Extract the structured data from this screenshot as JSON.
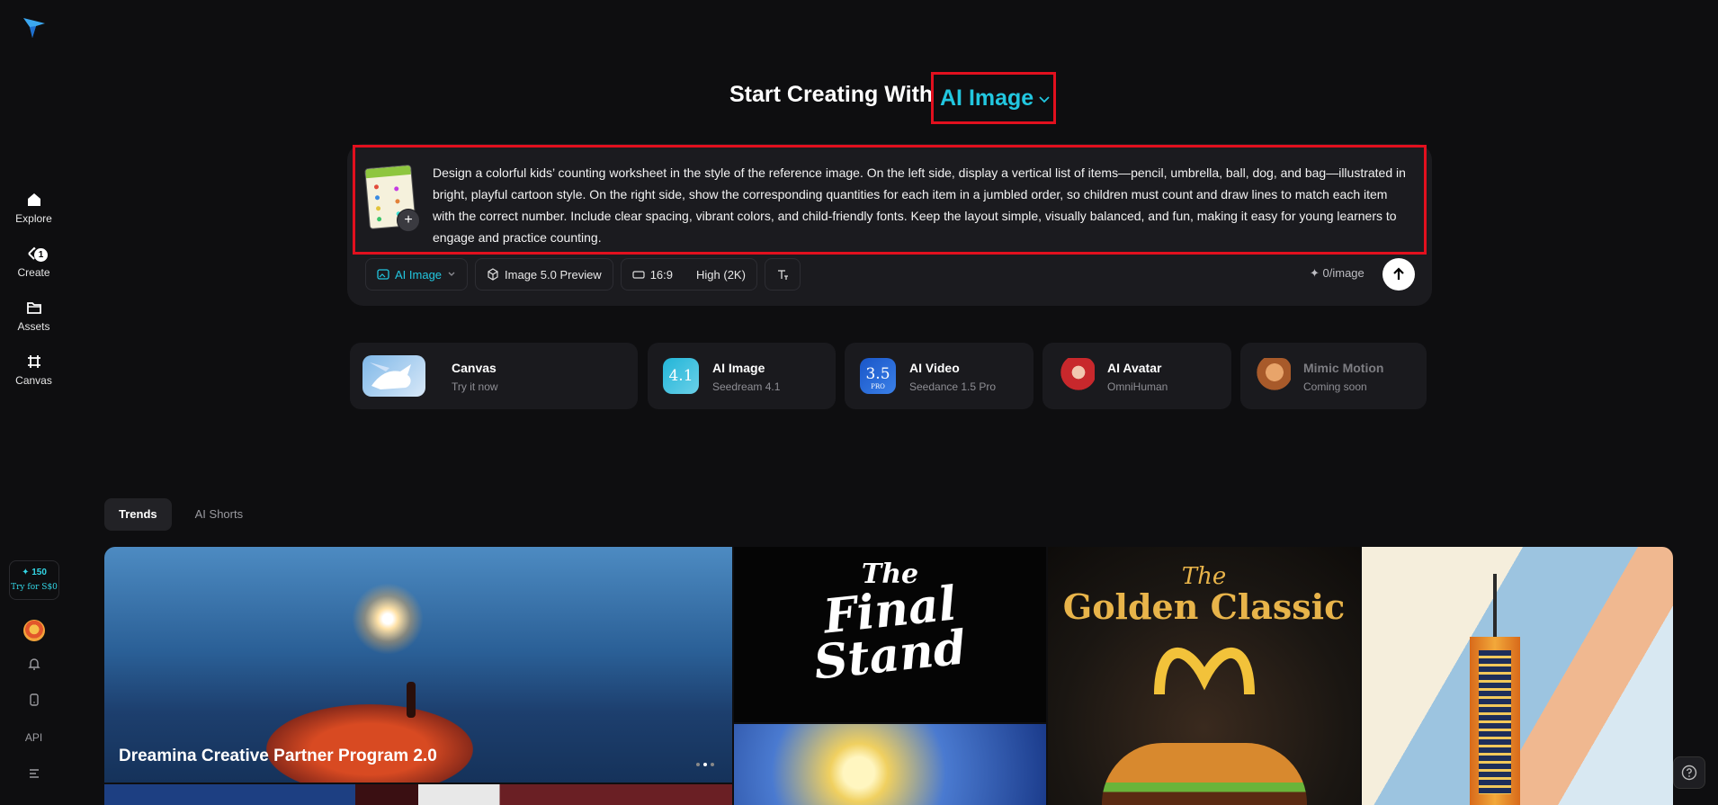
{
  "sidebar": {
    "items": [
      {
        "label": "Explore",
        "icon": "home-icon"
      },
      {
        "label": "Create",
        "icon": "create-icon",
        "badge": "1"
      },
      {
        "label": "Assets",
        "icon": "folder-icon"
      },
      {
        "label": "Canvas",
        "icon": "canvas-icon"
      }
    ],
    "credits": {
      "amount": "✦ 150",
      "cta": "Try for S$0"
    },
    "api_label": "API"
  },
  "headline": {
    "prefix": "Start Creating With",
    "mode": "AI Image"
  },
  "composer": {
    "prompt": "Design a colorful kids’ counting worksheet in the style of the reference image. On the left side, display a vertical list of items—pencil, umbrella, ball, dog, and bag—illustrated in bright, playful cartoon style. On the right side, show the corresponding quantities for each item in a jumbled order, so children must count and draw lines to match each item with the correct number. Include clear spacing, vibrant colors, and child-friendly fonts. Keep the layout simple, visually balanced, and fun, making it easy for young learners to engage and practice counting.",
    "add_symbol": "+",
    "toolbar": {
      "mode": "AI Image",
      "model": "Image 5.0 Preview",
      "ratio": "16:9",
      "quality": "High (2K)"
    },
    "cost": "✦ 0/image"
  },
  "feature_cards": [
    {
      "title": "Canvas",
      "subtitle": "Try it now"
    },
    {
      "title": "AI Image",
      "subtitle": "Seedream 4.1",
      "icon_text": "4.1"
    },
    {
      "title": "AI Video",
      "subtitle": "Seedance 1.5 Pro",
      "icon_text": "3.5",
      "icon_sub": "PRO"
    },
    {
      "title": "AI Avatar",
      "subtitle": "OmniHuman"
    },
    {
      "title": "Mimic Motion",
      "subtitle": "Coming soon"
    }
  ],
  "tabs": [
    "Trends",
    "AI Shorts"
  ],
  "gallery": {
    "banner_title": "Dreamina Creative Partner Program 2.0",
    "poster_1_line1": "The",
    "poster_1_line2": "Final",
    "poster_1_line3": "Stand",
    "poster_2_line1": "The",
    "poster_2_line2": "Golden Classic"
  },
  "colors": {
    "accent": "#22c7e0",
    "highlight_border": "#e2101e",
    "background": "#0e0e10"
  }
}
